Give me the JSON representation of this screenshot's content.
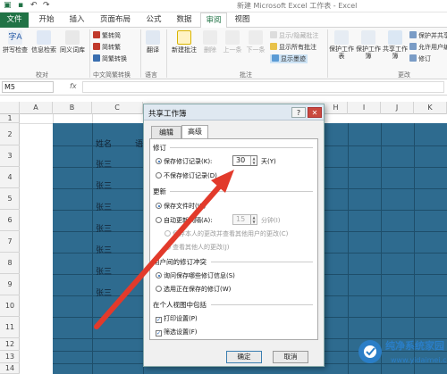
{
  "window": {
    "title": "新建 Microsoft Excel 工作表 - Excel"
  },
  "tabs": [
    "文件",
    "开始",
    "插入",
    "页面布局",
    "公式",
    "数据",
    "审阅",
    "视图"
  ],
  "active_tab": "审阅",
  "ribbon": {
    "proofing": {
      "spell": "拼写检查",
      "research": "信息检索",
      "thesaurus": "同义词库",
      "group": "校对"
    },
    "chinese": {
      "to_trad": "繁转简",
      "to_simp": "简转繁",
      "convert": "简繁转换",
      "group": "中文简繁转换"
    },
    "language": {
      "translate": "翻译",
      "group": "语言"
    },
    "comments": {
      "new": "新建批注",
      "delete": "删除",
      "prev": "上一条",
      "next": "下一条",
      "show_hide": "显示/隐藏批注",
      "show_all": "显示所有批注",
      "show_ink": "显示墨迹",
      "group": "批注"
    },
    "changes": {
      "protect_sheet": "保护工作表",
      "protect_workbook": "保护工作簿",
      "share_workbook": "共享工作簿",
      "protect_share": "保护并共享",
      "allow_edit": "允许用户编",
      "track": "修订",
      "group": "更改"
    }
  },
  "formula_bar": {
    "name_box": "M5",
    "fx": "fx"
  },
  "columns": [
    "A",
    "B",
    "C",
    "H",
    "I",
    "J",
    "K"
  ],
  "rows": [
    "1",
    "2",
    "3",
    "4",
    "5",
    "6",
    "7",
    "8",
    "9",
    "10",
    "11",
    "12",
    "13",
    "14"
  ],
  "cells": {
    "header_name": "姓名",
    "header_partial": "语",
    "names": [
      "张三",
      "张三",
      "张三",
      "张三",
      "张三",
      "张三",
      "张三"
    ]
  },
  "dialog": {
    "title": "共享工作簿",
    "help": "?",
    "close": "✕",
    "tabs": [
      "编辑",
      "高级"
    ],
    "active_tab": "高级",
    "track_changes": {
      "section": "修订",
      "keep": "保存修订记录(K):",
      "keep_days": "30",
      "days_unit": "天(Y)",
      "dont_keep": "不保存修订记录(D)"
    },
    "update": {
      "section": "更新",
      "on_save": "保存文件时(W)",
      "auto": "自动更新间隔(A):",
      "interval": "15",
      "interval_unit": "分钟(I)",
      "save_mine": "保存本人的更改并查看其他用户的更改(C)",
      "just_see": "查看其他人的更改(J)"
    },
    "conflicts": {
      "section": "用户间的修订冲突",
      "ask": "询问保存哪些修订信息(S)",
      "save_wins": "选用正在保存的修订(W)"
    },
    "personal_view": {
      "section": "在个人视图中包括",
      "print": "打印设置(P)",
      "filter": "筛选设置(F)"
    },
    "ok": "确定",
    "cancel": "取消"
  },
  "watermark": {
    "title": "纯净系统家园",
    "url": "www.yidaimei.com"
  },
  "colors": {
    "excel_green": "#217346",
    "cell_fill": "#2e6b8f",
    "arrow": "#e23a2b"
  }
}
